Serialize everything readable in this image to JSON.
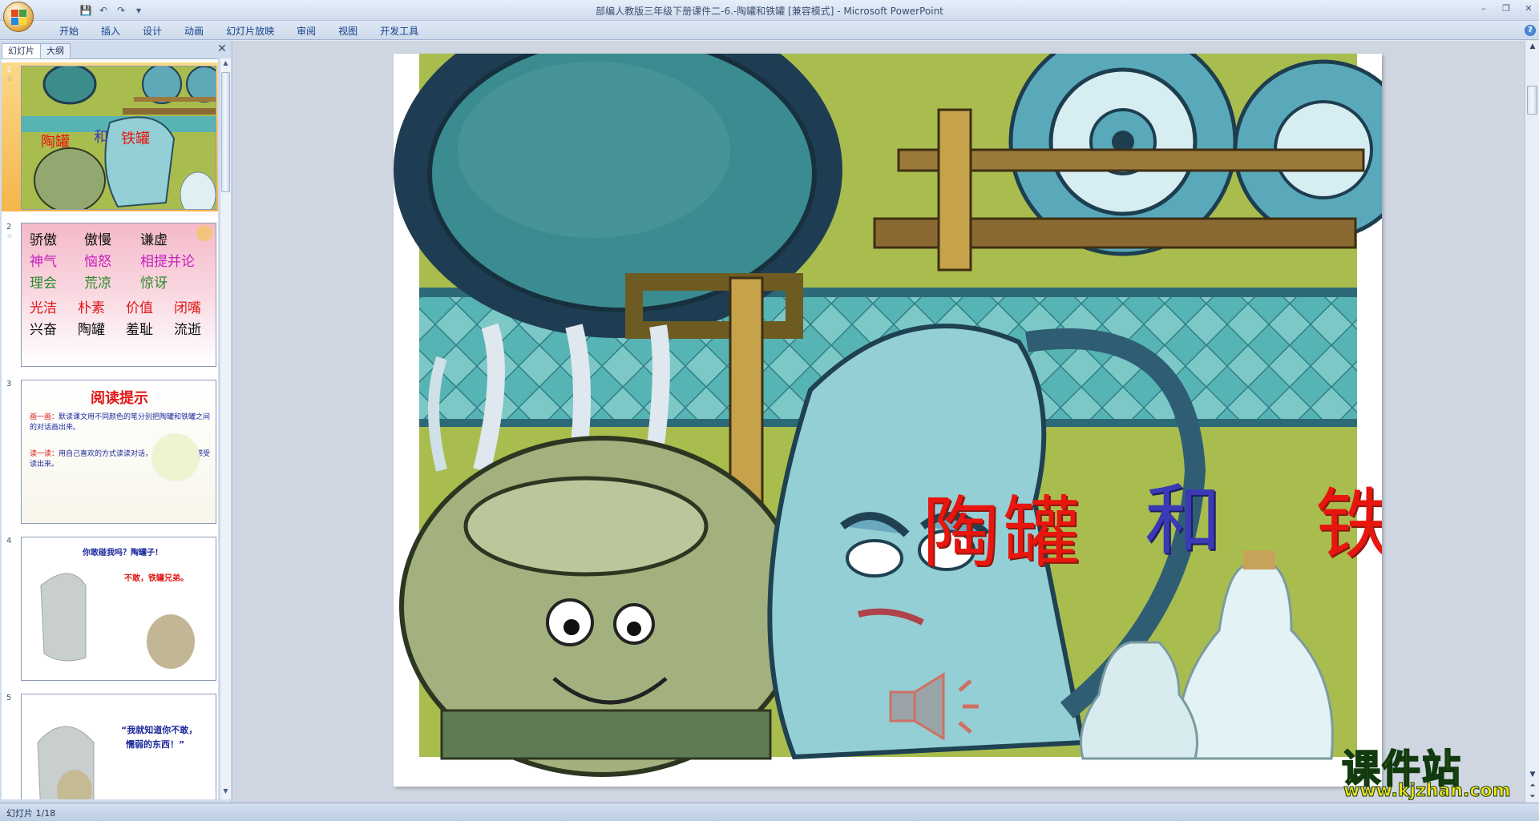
{
  "window": {
    "title": "部编人教版三年级下册课件二-6.-陶罐和铁罐 [兼容模式] - Microsoft PowerPoint",
    "minimize": "–",
    "restore": "❐",
    "close": "✕"
  },
  "qat": {
    "save": "💾",
    "undo": "↶",
    "redo": "↷",
    "customize": "▾"
  },
  "ribbon": {
    "tabs": [
      "开始",
      "插入",
      "设计",
      "动画",
      "幻灯片放映",
      "审阅",
      "视图",
      "开发工具"
    ],
    "help": "?"
  },
  "pane": {
    "tabs": [
      "幻灯片",
      "大纲"
    ],
    "close": "✕"
  },
  "thumbnails": [
    {
      "num": "1",
      "title_a": "陶罐",
      "title_b": "和",
      "title_c": "铁罐"
    },
    {
      "num": "2",
      "rows": [
        {
          "words": [
            "骄傲",
            "傲慢",
            "谦虚"
          ],
          "color": "#111111"
        },
        {
          "words": [
            "神气",
            "恼怒",
            "相提并论"
          ],
          "color": "#c61fbe"
        },
        {
          "words": [
            "理会",
            "荒凉",
            "惊讶"
          ],
          "color": "#2b8a2b"
        },
        {
          "words": [
            "光洁",
            "朴素",
            "价值",
            "闭嘴"
          ],
          "color": "#e01616"
        },
        {
          "words": [
            "兴奋",
            "陶罐",
            "羞耻",
            "流逝"
          ],
          "color": "#111111"
        }
      ]
    },
    {
      "num": "3",
      "heading": "阅读提示",
      "p1_label": "画一画：",
      "p1": "默读课文用不同颜色的笔分别把陶罐和铁罐之间的对话画出来。",
      "p2_label": "读一读：",
      "p2": "用自己喜欢的方式读读对话，把他们的不同感受读出来。"
    },
    {
      "num": "4",
      "line1": "你敢碰我吗？陶罐子！",
      "line2": "不敢，铁罐兄弟。"
    },
    {
      "num": "5",
      "line1": "“我就知道你不敢，",
      "line2": "懦弱的东西！”"
    }
  ],
  "slide": {
    "title_a": "陶罐",
    "title_b": "和",
    "title_c": "铁罐"
  },
  "watermark": {
    "cn": "课件站",
    "en": "www.kjzhan.com"
  },
  "status": {
    "text": "幻灯片 1/18"
  }
}
